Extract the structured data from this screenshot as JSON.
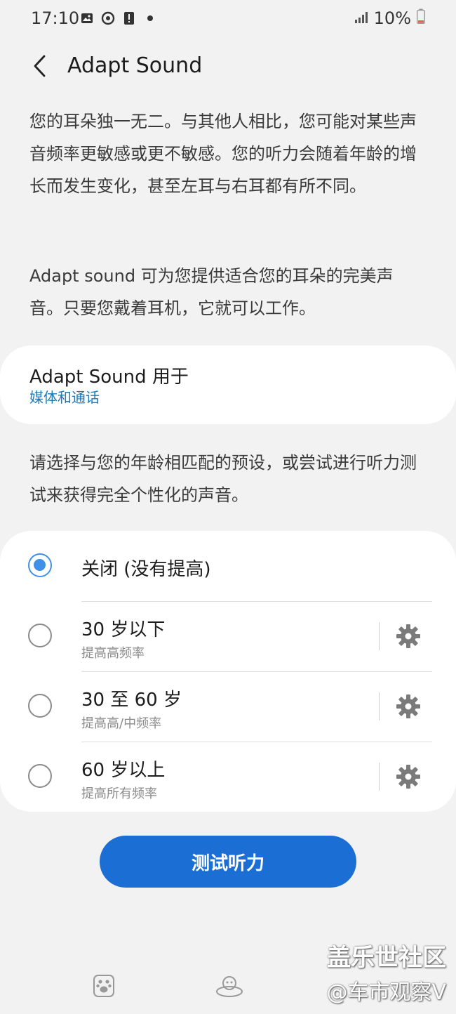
{
  "status_bar": {
    "time": "17:10",
    "battery": "10%",
    "icons": [
      "image-icon",
      "sync-icon",
      "alert-icon",
      "dot-icon",
      "signal-icon",
      "battery-icon"
    ]
  },
  "header": {
    "title": "Adapt Sound"
  },
  "intro": {
    "paragraph_1": "您的耳朵独一无二。与其他人相比，您可能对某些声音频率更敏感或更不敏感。您的听力会随着年龄的增长而发生变化，甚至左耳与右耳都有所不同。",
    "paragraph_2": "Adapt sound 可为您提供适合您的耳朵的完美声音。只要您戴着耳机，它就可以工作。"
  },
  "usage": {
    "title": "Adapt Sound 用于",
    "value": "媒体和通话"
  },
  "preset_hint": "请选择与您的年龄相匹配的预设，或尝试进行听力测试来获得完全个性化的声音。",
  "options": [
    {
      "label": "关闭 (没有提高)",
      "sub": "",
      "selected": true
    },
    {
      "label": "30 岁以下",
      "sub": "提高高频率",
      "selected": false
    },
    {
      "label": "30 至 60 岁",
      "sub": "提高高/中频率",
      "selected": false
    },
    {
      "label": "60 岁以上",
      "sub": "提高所有频率",
      "selected": false
    }
  ],
  "test_button": {
    "label": "测试听力"
  },
  "watermark": {
    "line_1": "盖乐世社区",
    "line_2": "@车市观察V"
  },
  "colors": {
    "accent": "#3e91e6",
    "button": "#1b6fd4",
    "link": "#1d79b8",
    "background": "#f2f2f2"
  }
}
